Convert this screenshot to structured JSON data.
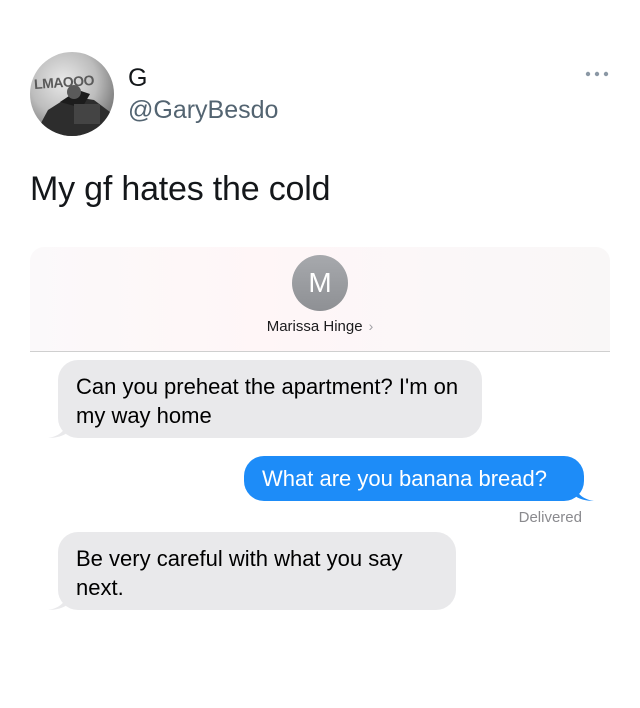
{
  "tweet": {
    "display_name": "G",
    "handle": "@GaryBesdo",
    "text": "My gf hates the cold",
    "avatar_text": "LMAOOO",
    "more_icon": "more-horizontal-icon"
  },
  "conversation": {
    "contact_initial": "M",
    "contact_name": "Marissa Hinge",
    "contact_chevron": "›",
    "messages": [
      {
        "direction": "received",
        "text": "Can you preheat the apartment? I'm on my way home"
      },
      {
        "direction": "sent",
        "text": "What are you banana bread?"
      },
      {
        "direction": "received",
        "text": "Be very careful with what you say next."
      }
    ],
    "delivery_status": "Delivered"
  },
  "colors": {
    "sent_bubble": "#1d8cf8",
    "received_bubble": "#e9e9eb",
    "handle_gray": "#536471"
  }
}
